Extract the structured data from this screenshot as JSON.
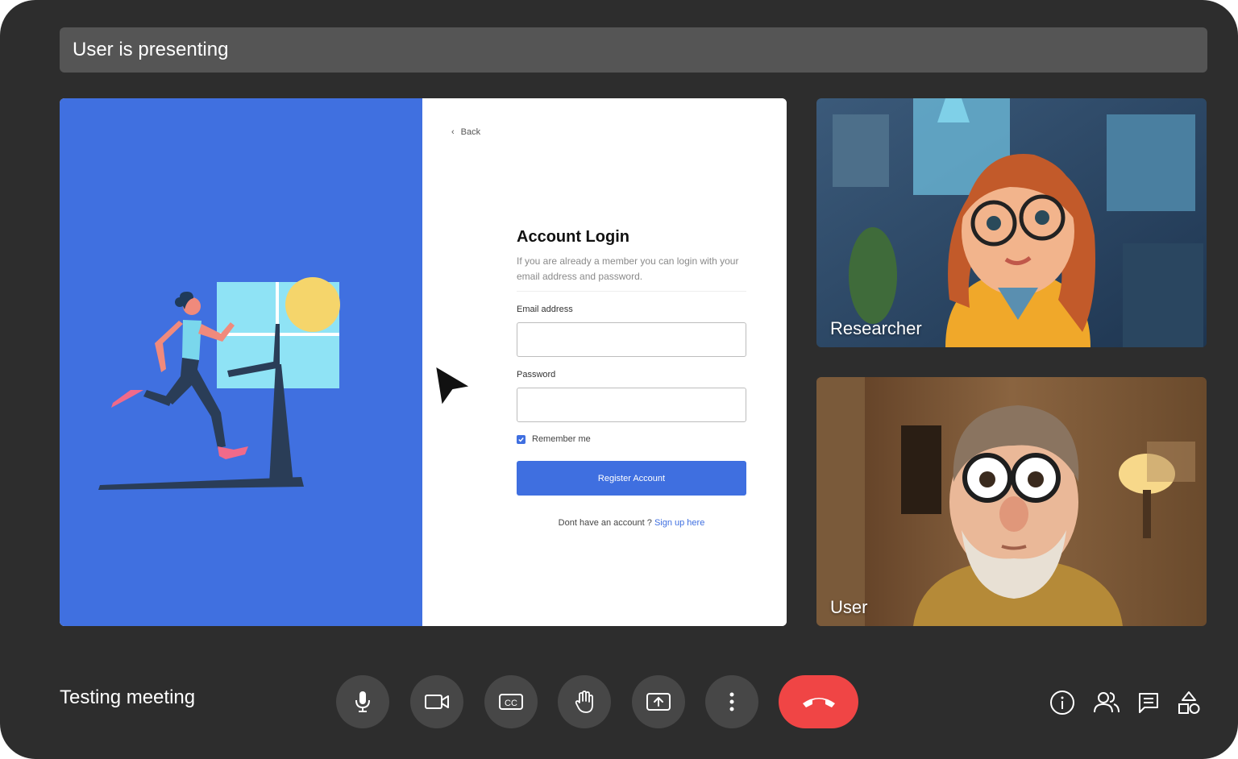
{
  "header": {
    "presenting_text": "User is presenting"
  },
  "shared_screen": {
    "back_label": "Back",
    "login": {
      "title": "Account Login",
      "description": "If you are already a member you can login with your email address and password.",
      "email_label": "Email address",
      "email_value": "",
      "password_label": "Password",
      "password_value": "",
      "remember_label": "Remember me",
      "remember_checked": true,
      "register_label": "Register Account",
      "signup_prompt": "Dont have an account ?",
      "signup_link": "Sign up here"
    },
    "colors": {
      "panel_blue": "#4070e0",
      "button_blue": "#3f6fe0"
    }
  },
  "participants": [
    {
      "name": "Researcher"
    },
    {
      "name": "User"
    }
  ],
  "footer": {
    "meeting_name": "Testing meeting",
    "controls": [
      "microphone-icon",
      "camera-icon",
      "captions-icon",
      "raise-hand-icon",
      "present-screen-icon",
      "more-options-icon",
      "end-call-icon"
    ],
    "side_icons": [
      "info-icon",
      "people-icon",
      "chat-icon",
      "activities-icon"
    ],
    "end_call_color": "#f04545"
  }
}
